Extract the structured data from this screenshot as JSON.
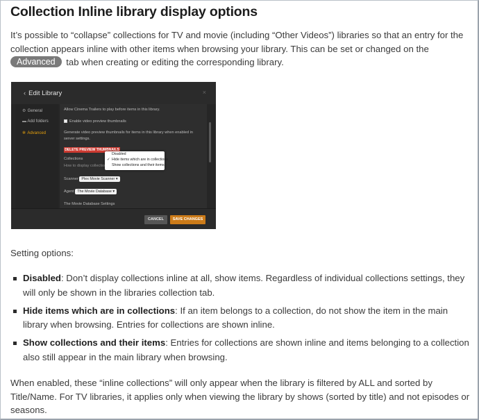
{
  "title": "Collection Inline library display options",
  "intro": {
    "before": "It’s possible to “collapse” collections for TV and movie (including “Other Videos”) libraries so that an entry for the collection appears inline with other items when browsing your library. This can be set or changed on the ",
    "pill": "Advanced",
    "after": " tab when creating or editing the corresponding library."
  },
  "dialog": {
    "title": "Edit Library",
    "close": "×",
    "sidebar": [
      {
        "label": "General",
        "icon": "gear-icon"
      },
      {
        "label": "Add folders",
        "icon": "folder-icon"
      },
      {
        "label": "Advanced",
        "icon": "settings-icon"
      }
    ],
    "lines": {
      "cinema": "Allow Cinema Trailers to play before items in this library.",
      "thumbs_check": "Enable video preview thumbnails",
      "thumbs_desc1": "Generate video preview thumbnails for items in this library when enabled in",
      "thumbs_desc2": "server settings.",
      "delete_btn": "DELETE PREVIEW THUMBNAILS",
      "collections_label": "Collections",
      "how_to": "How to display collections",
      "scanner_label": "Scanner",
      "scanner_value": "Plex Movie Scanner",
      "agent_label": "Agent",
      "agent_value": "The Movie Database",
      "tmdb_settings": "The Movie Database Settings"
    },
    "dropdown": {
      "options": [
        "Disabled",
        "Hide items which are in collections",
        "Show collections and their items"
      ],
      "selected_mark": "✓"
    },
    "buttons": {
      "cancel": "CANCEL",
      "save": "SAVE CHANGES"
    }
  },
  "setting_options_label": "Setting options:",
  "options": [
    {
      "name": "Disabled",
      "desc": ": Don’t display collections inline at all, show items. Regardless of individual collections settings, they will only be shown in the libraries collection tab."
    },
    {
      "name": "Hide items which are in collections",
      "desc": ": If an item belongs to a collection, do not show the item in the main library when browsing. Entries for collections are shown inline."
    },
    {
      "name": "Show collections and their items",
      "desc": ": Entries for collections are shown inline and items belonging to a collection also still appear in the main library when browsing."
    }
  ],
  "outro": "When enabled, these “inline collections” will only appear when the library is filtered by ALL and sorted by Title/Name. For TV libraries, it applies only when viewing the library by shows (sorted by title) and not episodes or seasons.",
  "colors": {
    "accent": "#e5a00d",
    "save": "#cc7b19",
    "delete": "#cc3a31",
    "pill": "#7a7a7a"
  }
}
